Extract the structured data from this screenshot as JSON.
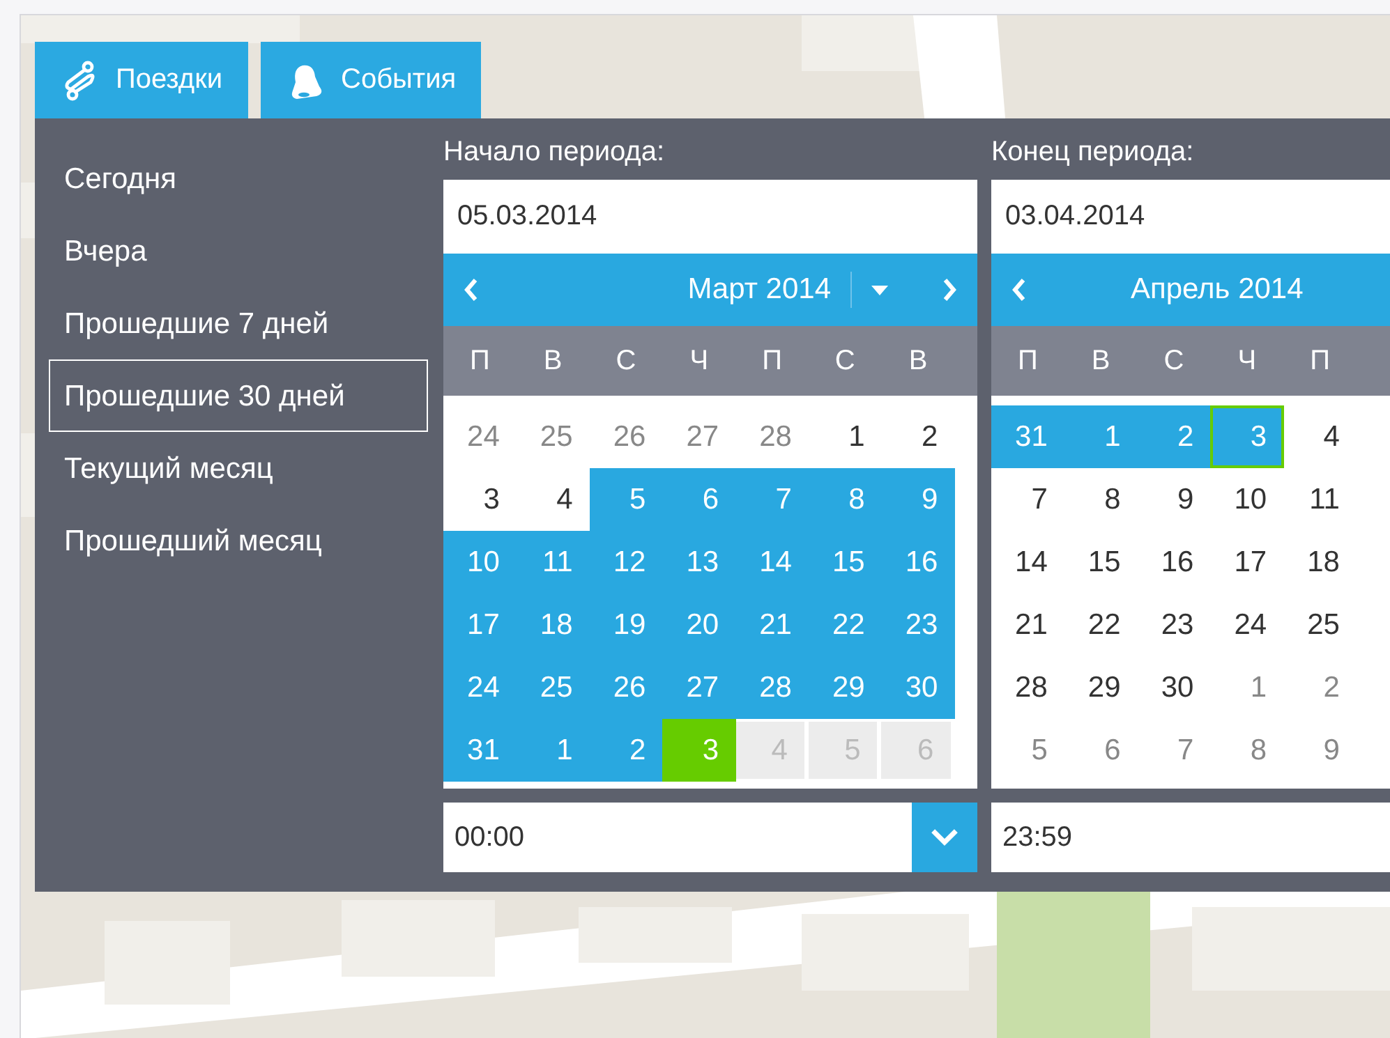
{
  "tabs": [
    {
      "label": "Поездки"
    },
    {
      "label": "События"
    }
  ],
  "presets": [
    {
      "label": "Сегодня",
      "selected": false
    },
    {
      "label": "Вчера",
      "selected": false
    },
    {
      "label": "Прошедшие 7 дней",
      "selected": false
    },
    {
      "label": "Прошедшие 30 дней",
      "selected": true
    },
    {
      "label": "Текущий месяц",
      "selected": false
    },
    {
      "label": "Прошедший месяц",
      "selected": false
    }
  ],
  "calendars": [
    {
      "label": "Начало периода:",
      "date": "05.03.2014",
      "month": "Март 2014",
      "time": "00:00",
      "has_menu": true,
      "weekdays": [
        "П",
        "В",
        "С",
        "Ч",
        "П",
        "С",
        "В"
      ],
      "weeks": [
        [
          {
            "day": "24",
            "kind": "muted"
          },
          {
            "day": "25",
            "kind": "muted"
          },
          {
            "day": "26",
            "kind": "muted"
          },
          {
            "day": "27",
            "kind": "muted"
          },
          {
            "day": "28",
            "kind": "muted"
          },
          {
            "day": "1",
            "kind": "normal"
          },
          {
            "day": "2",
            "kind": "normal"
          }
        ],
        [
          {
            "day": "3",
            "kind": "normal"
          },
          {
            "day": "4",
            "kind": "normal"
          },
          {
            "day": "5",
            "kind": "range"
          },
          {
            "day": "6",
            "kind": "range"
          },
          {
            "day": "7",
            "kind": "range"
          },
          {
            "day": "8",
            "kind": "range"
          },
          {
            "day": "9",
            "kind": "range"
          }
        ],
        [
          {
            "day": "10",
            "kind": "range"
          },
          {
            "day": "11",
            "kind": "range"
          },
          {
            "day": "12",
            "kind": "range"
          },
          {
            "day": "13",
            "kind": "range"
          },
          {
            "day": "14",
            "kind": "range"
          },
          {
            "day": "15",
            "kind": "range"
          },
          {
            "day": "16",
            "kind": "range"
          }
        ],
        [
          {
            "day": "17",
            "kind": "range"
          },
          {
            "day": "18",
            "kind": "range"
          },
          {
            "day": "19",
            "kind": "range"
          },
          {
            "day": "20",
            "kind": "range"
          },
          {
            "day": "21",
            "kind": "range"
          },
          {
            "day": "22",
            "kind": "range"
          },
          {
            "day": "23",
            "kind": "range"
          }
        ],
        [
          {
            "day": "24",
            "kind": "range"
          },
          {
            "day": "25",
            "kind": "range"
          },
          {
            "day": "26",
            "kind": "range"
          },
          {
            "day": "27",
            "kind": "range"
          },
          {
            "day": "28",
            "kind": "range"
          },
          {
            "day": "29",
            "kind": "range"
          },
          {
            "day": "30",
            "kind": "range"
          }
        ],
        [
          {
            "day": "31",
            "kind": "range"
          },
          {
            "day": "1",
            "kind": "range"
          },
          {
            "day": "2",
            "kind": "range"
          },
          {
            "day": "3",
            "kind": "today"
          },
          {
            "day": "4",
            "kind": "disabled"
          },
          {
            "day": "5",
            "kind": "disabled"
          },
          {
            "day": "6",
            "kind": "disabled"
          }
        ]
      ]
    },
    {
      "label": "Конец периода:",
      "date": "03.04.2014",
      "month": "Апрель 2014",
      "time": "23:59",
      "has_menu": false,
      "weekdays": [
        "П",
        "В",
        "С",
        "Ч",
        "П"
      ],
      "weeks": [
        [
          {
            "day": "31",
            "kind": "range"
          },
          {
            "day": "1",
            "kind": "range"
          },
          {
            "day": "2",
            "kind": "range"
          },
          {
            "day": "3",
            "kind": "edge"
          },
          {
            "day": "4",
            "kind": "normal"
          }
        ],
        [
          {
            "day": "7",
            "kind": "normal"
          },
          {
            "day": "8",
            "kind": "normal"
          },
          {
            "day": "9",
            "kind": "normal"
          },
          {
            "day": "10",
            "kind": "normal"
          },
          {
            "day": "11",
            "kind": "normal"
          }
        ],
        [
          {
            "day": "14",
            "kind": "normal"
          },
          {
            "day": "15",
            "kind": "normal"
          },
          {
            "day": "16",
            "kind": "normal"
          },
          {
            "day": "17",
            "kind": "normal"
          },
          {
            "day": "18",
            "kind": "normal"
          }
        ],
        [
          {
            "day": "21",
            "kind": "normal"
          },
          {
            "day": "22",
            "kind": "normal"
          },
          {
            "day": "23",
            "kind": "normal"
          },
          {
            "day": "24",
            "kind": "normal"
          },
          {
            "day": "25",
            "kind": "normal"
          }
        ],
        [
          {
            "day": "28",
            "kind": "normal"
          },
          {
            "day": "29",
            "kind": "normal"
          },
          {
            "day": "30",
            "kind": "normal"
          },
          {
            "day": "1",
            "kind": "muted"
          },
          {
            "day": "2",
            "kind": "muted"
          }
        ],
        [
          {
            "day": "5",
            "kind": "muted"
          },
          {
            "day": "6",
            "kind": "muted"
          },
          {
            "day": "7",
            "kind": "muted"
          },
          {
            "day": "8",
            "kind": "muted"
          },
          {
            "day": "9",
            "kind": "muted"
          }
        ]
      ]
    }
  ]
}
